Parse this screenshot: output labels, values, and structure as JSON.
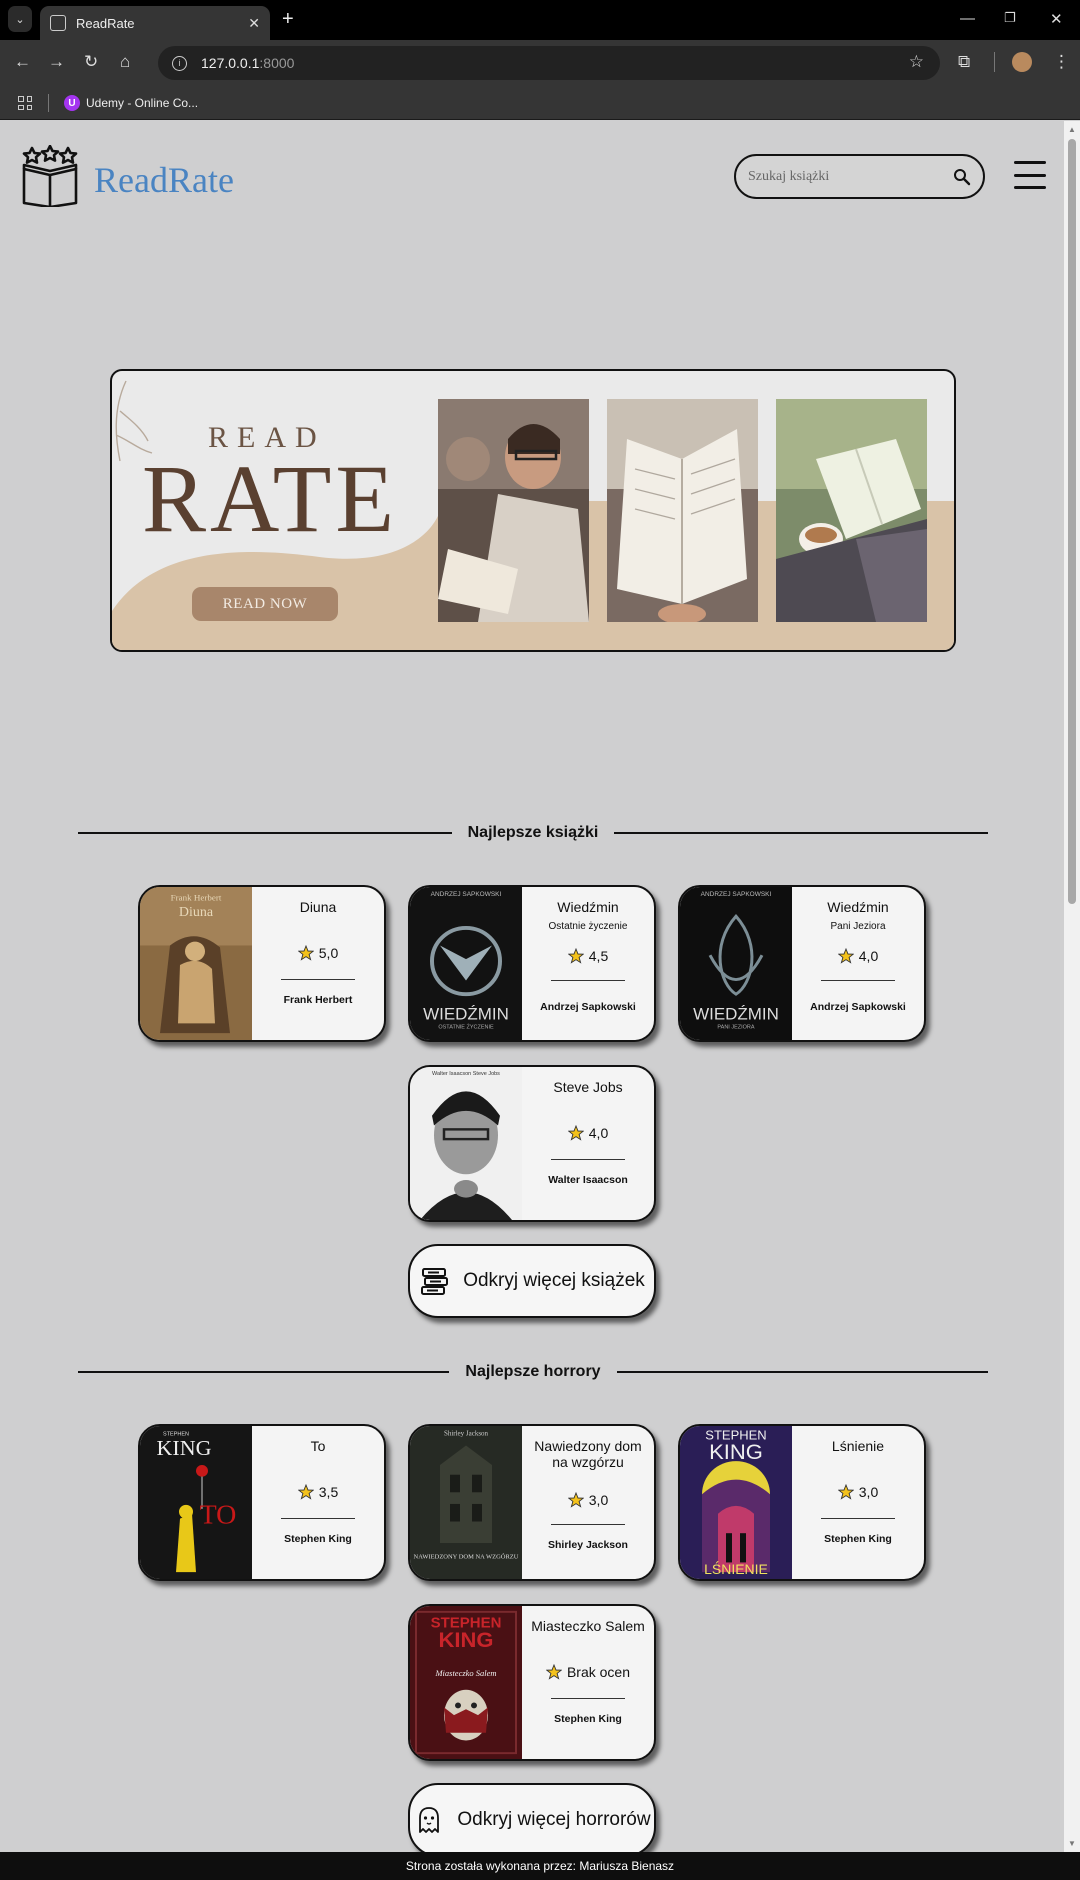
{
  "browser": {
    "tab_title": "ReadRate",
    "url_host": "127.0.0.1",
    "url_port": ":8000",
    "bookmark_label": "Udemy - Online Co...",
    "bookmark_icon": "U"
  },
  "header": {
    "brand": "ReadRate",
    "search_placeholder": "Szukaj książki"
  },
  "banner": {
    "line1": "READ",
    "line2": "RATE",
    "button": "READ NOW"
  },
  "sections": [
    {
      "title": "Najlepsze książki",
      "books": [
        {
          "title": "Diuna",
          "subtitle": "",
          "rating": "5,0",
          "author": "Frank Herbert"
        },
        {
          "title": "Wiedźmin",
          "subtitle": "Ostatnie życzenie",
          "rating": "4,5",
          "author": "Andrzej Sapkowski"
        },
        {
          "title": "Wiedźmin",
          "subtitle": "Pani Jeziora",
          "rating": "4,0",
          "author": "Andrzej Sapkowski"
        },
        {
          "title": "Steve Jobs",
          "subtitle": "",
          "rating": "4,0",
          "author": "Walter Isaacson"
        }
      ],
      "more": "Odkryj więcej książek"
    },
    {
      "title": "Najlepsze horrory",
      "books": [
        {
          "title": "To",
          "subtitle": "",
          "rating": "3,5",
          "author": "Stephen King"
        },
        {
          "title": "Nawiedzony dom na wzgórzu",
          "subtitle": "",
          "rating": "3,0",
          "author": "Shirley Jackson"
        },
        {
          "title": "Lśnienie",
          "subtitle": "",
          "rating": "3,0",
          "author": "Stephen King"
        },
        {
          "title": "Miasteczko Salem",
          "subtitle": "",
          "rating": "Brak ocen",
          "author": "Stephen King"
        }
      ],
      "more": "Odkryj więcej horrorów"
    }
  ],
  "covers": [
    {
      "top": "Frank Herbert",
      "main": "Diuna"
    },
    {
      "top": "ANDRZEJ SAPKOWSKI",
      "main": "WIEDŹMIN",
      "sub": "OSTATNIE ŻYCZENIE"
    },
    {
      "top": "ANDRZEJ SAPKOWSKI",
      "main": "WIEDŹMIN",
      "sub": "PANI JEZIORA"
    },
    {
      "top": "Walter Isaacson  Steve Jobs"
    },
    {
      "top": "STEPHEN",
      "main": "KING",
      "sub": "TO"
    },
    {
      "top": "Shirley Jackson",
      "main": "NAWIEDZONY DOM NA WZGÓRZU"
    },
    {
      "top": "STEPHEN",
      "main": "KING",
      "sub": "LŚNIENIE"
    },
    {
      "top": "STEPHEN",
      "main": "KING",
      "sub": "Miasteczko Salem"
    }
  ],
  "footer": "Strona została wykonana przez: Mariusza Bienasz",
  "colors": {
    "brand": "#4a84c2",
    "page_bg": "#cfcfd0",
    "banner_accent": "#a8866b"
  }
}
